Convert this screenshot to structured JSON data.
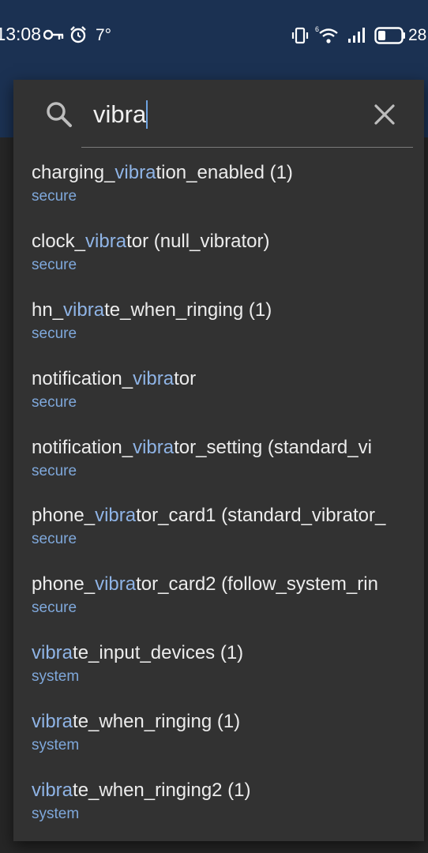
{
  "status_bar": {
    "time": "13:08",
    "temperature": "7°",
    "battery": "28",
    "icons": [
      "key-icon",
      "alarm-icon",
      "vibrate-icon",
      "wifi-icon",
      "signal-icon",
      "battery-icon"
    ]
  },
  "search": {
    "query": "vibra",
    "icon": "search-icon",
    "clear_icon": "close-icon"
  },
  "results": [
    {
      "prefix": "charging_",
      "match": "vibra",
      "suffix": "tion_enabled (1)",
      "namespace": "secure"
    },
    {
      "prefix": "clock_",
      "match": "vibra",
      "suffix": "tor (null_vibrator)",
      "namespace": "secure"
    },
    {
      "prefix": "hn_",
      "match": "vibra",
      "suffix": "te_when_ringing (1)",
      "namespace": "secure"
    },
    {
      "prefix": "notification_",
      "match": "vibra",
      "suffix": "tor",
      "namespace": "secure"
    },
    {
      "prefix": "notification_",
      "match": "vibra",
      "suffix": "tor_setting (standard_vi",
      "namespace": "secure"
    },
    {
      "prefix": "phone_",
      "match": "vibra",
      "suffix": "tor_card1 (standard_vibrator_",
      "namespace": "secure"
    },
    {
      "prefix": "phone_",
      "match": "vibra",
      "suffix": "tor_card2 (follow_system_rin",
      "namespace": "secure"
    },
    {
      "prefix": "",
      "match": "vibra",
      "suffix": "te_input_devices (1)",
      "namespace": "system"
    },
    {
      "prefix": "",
      "match": "vibra",
      "suffix": "te_when_ringing (1)",
      "namespace": "system"
    },
    {
      "prefix": "",
      "match": "vibra",
      "suffix": "te_when_ringing2 (1)",
      "namespace": "system"
    }
  ],
  "colors": {
    "status_bar": "#1b3152",
    "panel": "#323232",
    "highlight": "#8fb4e6",
    "namespace": "#7fa8db"
  }
}
